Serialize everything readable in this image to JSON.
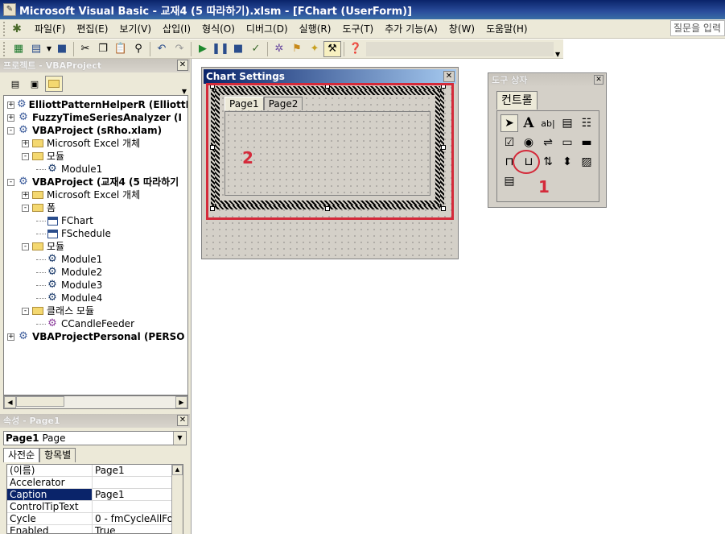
{
  "window": {
    "title": "Microsoft Visual Basic - 교재4 (5 따라하기).xlsm - [FChart (UserForm)]"
  },
  "menu": {
    "items": [
      "파일(F)",
      "편집(E)",
      "보기(V)",
      "삽입(I)",
      "형식(O)",
      "디버그(D)",
      "실행(R)",
      "도구(T)",
      "추가 기능(A)",
      "창(W)",
      "도움말(H)"
    ],
    "help_placeholder": "질문을 입력"
  },
  "project": {
    "header": "프로젝트 - VBAProject",
    "tree": [
      {
        "label": "ElliottPatternHelperR (ElliottP",
        "level": 0,
        "bold": true,
        "icon": "gear-icon",
        "exp": "+"
      },
      {
        "label": "FuzzyTimeSeriesAnalyzer (I",
        "level": 0,
        "bold": true,
        "icon": "gear-icon",
        "exp": "+"
      },
      {
        "label": "VBAProject (sRho.xlam)",
        "level": 0,
        "bold": true,
        "icon": "gear-icon",
        "exp": "-"
      },
      {
        "label": "Microsoft Excel 개체",
        "level": 1,
        "bold": false,
        "icon": "folder-icon",
        "exp": "+"
      },
      {
        "label": "모듈",
        "level": 1,
        "bold": false,
        "icon": "folder-icon",
        "exp": "-"
      },
      {
        "label": "Module1",
        "level": 2,
        "bold": false,
        "icon": "module-icon",
        "exp": ""
      },
      {
        "label": "VBAProject (교재4 (5 따라하기",
        "level": 0,
        "bold": true,
        "icon": "gear-icon",
        "exp": "-"
      },
      {
        "label": "Microsoft Excel 개체",
        "level": 1,
        "bold": false,
        "icon": "folder-icon",
        "exp": "+"
      },
      {
        "label": "폼",
        "level": 1,
        "bold": false,
        "icon": "folder-icon",
        "exp": "-"
      },
      {
        "label": "FChart",
        "level": 2,
        "bold": false,
        "icon": "form-icon",
        "exp": ""
      },
      {
        "label": "FSchedule",
        "level": 2,
        "bold": false,
        "icon": "form-icon",
        "exp": ""
      },
      {
        "label": "모듈",
        "level": 1,
        "bold": false,
        "icon": "folder-icon",
        "exp": "-"
      },
      {
        "label": "Module1",
        "level": 2,
        "bold": false,
        "icon": "module-icon",
        "exp": ""
      },
      {
        "label": "Module2",
        "level": 2,
        "bold": false,
        "icon": "module-icon",
        "exp": ""
      },
      {
        "label": "Module3",
        "level": 2,
        "bold": false,
        "icon": "module-icon",
        "exp": ""
      },
      {
        "label": "Module4",
        "level": 2,
        "bold": false,
        "icon": "module-icon",
        "exp": ""
      },
      {
        "label": "클래스 모듈",
        "level": 1,
        "bold": false,
        "icon": "folder-icon",
        "exp": "-"
      },
      {
        "label": "CCandleFeeder",
        "level": 2,
        "bold": false,
        "icon": "class-icon",
        "exp": ""
      },
      {
        "label": "VBAProjectPersonal (PERSO",
        "level": 0,
        "bold": true,
        "icon": "gear-icon",
        "exp": "+"
      }
    ]
  },
  "properties": {
    "header": "속성 - Page1",
    "object_name": "Page1",
    "object_type": "Page",
    "tabs": [
      "사전순",
      "항목별"
    ],
    "rows": [
      {
        "k": "(이름)",
        "v": "Page1"
      },
      {
        "k": "Accelerator",
        "v": ""
      },
      {
        "k": "Caption",
        "v": "Page1"
      },
      {
        "k": "ControlTipText",
        "v": ""
      },
      {
        "k": "Cycle",
        "v": "0 - fmCycleAllFo"
      },
      {
        "k": "Enabled",
        "v": "True"
      }
    ]
  },
  "form": {
    "title": "Chart Settings",
    "tabs": [
      "Page1",
      "Page2"
    ]
  },
  "toolbox": {
    "title": "도구 상자",
    "tab": "컨트롤"
  },
  "annotations": {
    "label_1": "1",
    "label_2": "2",
    "color": "#d42a3a"
  }
}
